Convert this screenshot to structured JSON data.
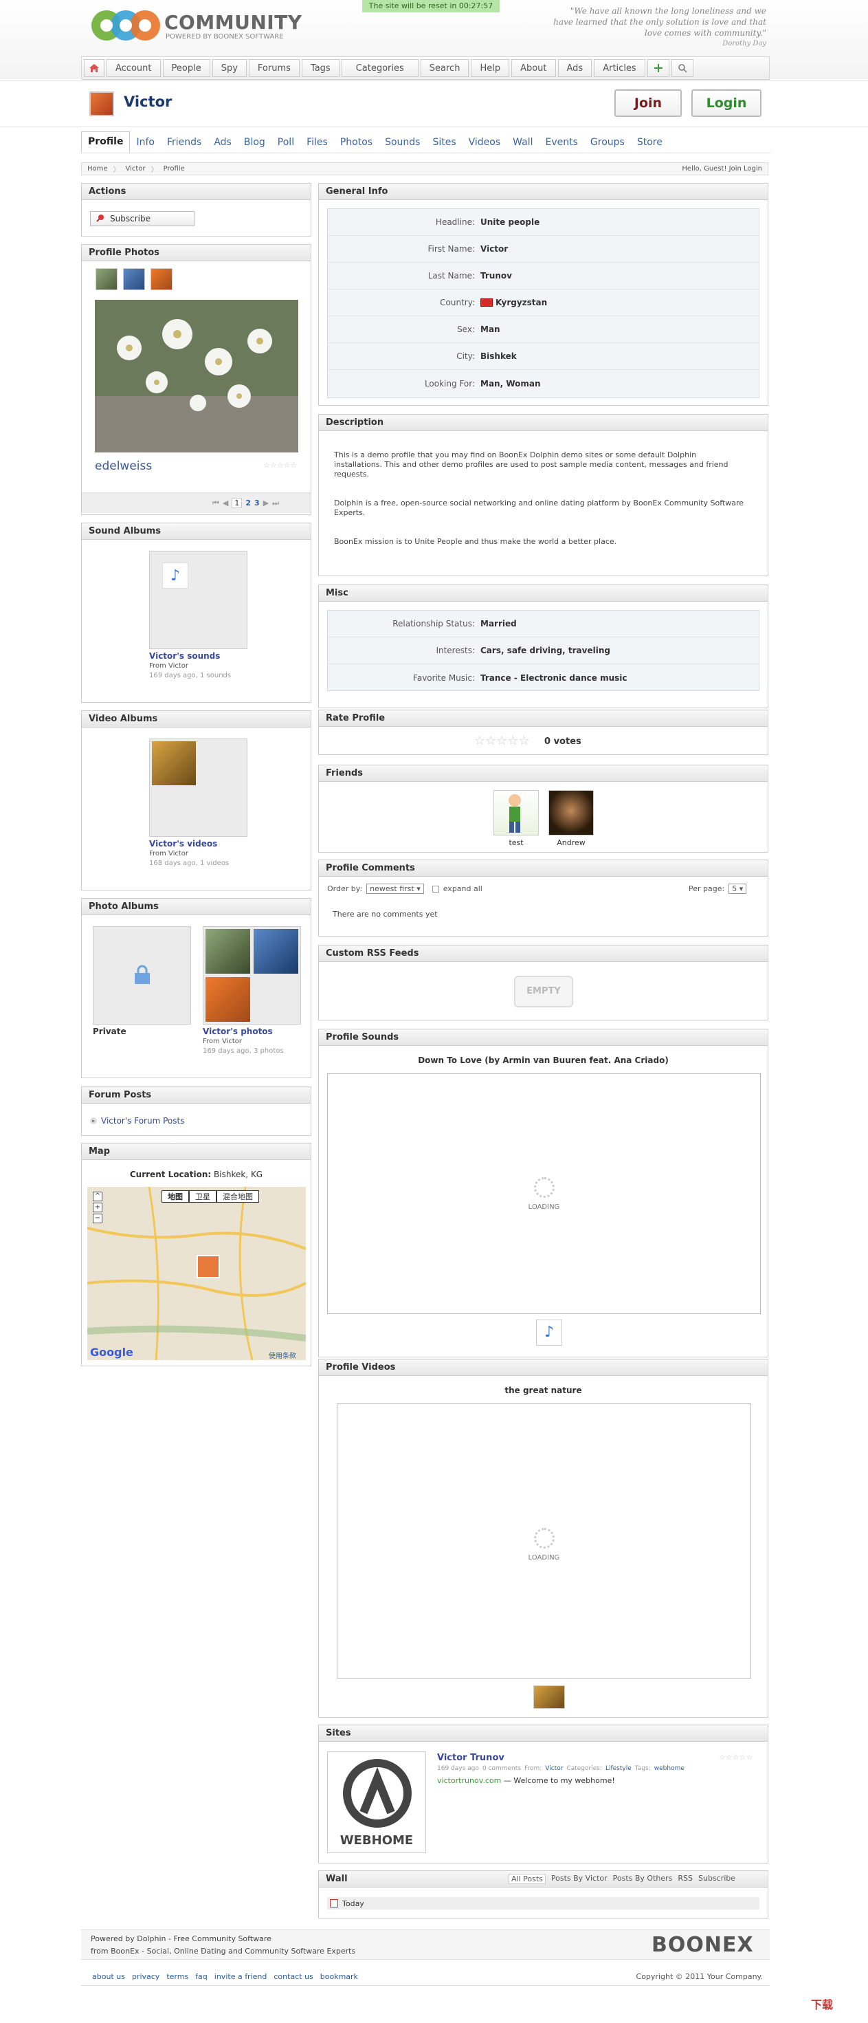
{
  "site": {
    "logo_title": "COMMUNITY",
    "logo_sub": "POWERED BY BOONEX SOFTWARE",
    "reset_notice": "The site will be reset in 00:27:57",
    "quote": "\"We have all known the long loneliness and we have learned that the only solution is love and that love comes with community.\"",
    "quote_author": "Dorothy Day"
  },
  "topnav": [
    "Account",
    "People",
    "Spy",
    "Forums",
    "Tags",
    "Categories",
    "Search",
    "Help",
    "About",
    "Ads",
    "Articles"
  ],
  "profile": {
    "name": "Victor",
    "join": "Join",
    "login": "Login"
  },
  "subnav": [
    "Profile",
    "Info",
    "Friends",
    "Ads",
    "Blog",
    "Poll",
    "Files",
    "Photos",
    "Sounds",
    "Sites",
    "Videos",
    "Wall",
    "Events",
    "Groups",
    "Store"
  ],
  "breadcrumb": [
    "Home",
    "Victor",
    "Profile"
  ],
  "hello": "Hello, Guest! Join Login",
  "actions": {
    "title": "Actions",
    "subscribe": "Subscribe"
  },
  "profile_photos": {
    "title": "Profile Photos",
    "caption": "edelweiss",
    "pages": [
      "1",
      "2",
      "3"
    ]
  },
  "sound_albums": {
    "title": "Sound Albums",
    "album": "Victor's sounds",
    "from": "From Victor",
    "meta": "169 days ago, 1 sounds"
  },
  "video_albums": {
    "title": "Video Albums",
    "album": "Victor's videos",
    "from": "From Victor",
    "meta": "168 days ago, 1 videos"
  },
  "photo_albums": {
    "title": "Photo Albums",
    "private": "Private",
    "album": "Victor's photos",
    "from": "From Victor",
    "meta": "169 days ago, 3 photos"
  },
  "forum_posts": {
    "title": "Forum Posts",
    "link": "Victor's Forum Posts"
  },
  "map": {
    "title": "Map",
    "location_label": "Current Location:",
    "location": "Bishkek, KG",
    "types": [
      "地图",
      "卫星",
      "混合地图"
    ],
    "terms": "使用条款",
    "google": "Google"
  },
  "general_info": {
    "title": "General Info",
    "rows": [
      {
        "label": "Headline:",
        "value": "Unite people"
      },
      {
        "label": "First Name:",
        "value": "Victor"
      },
      {
        "label": "Last Name:",
        "value": "Trunov"
      },
      {
        "label": "Country:",
        "value": "Kyrgyzstan"
      },
      {
        "label": "Sex:",
        "value": "Man"
      },
      {
        "label": "City:",
        "value": "Bishkek"
      },
      {
        "label": "Looking For:",
        "value": "Man, Woman"
      }
    ]
  },
  "description": {
    "title": "Description",
    "p1": "This is a demo profile that you may find on BoonEx Dolphin demo sites or some default Dolphin installations. This and other demo profiles are used to post sample media content, messages and friend requests.",
    "p2": "Dolphin is a free, open-source social networking and online dating platform by BoonEx Community Software Experts.",
    "p3": "BoonEx mission is to Unite People and thus make the world a better place."
  },
  "misc": {
    "title": "Misc",
    "rows": [
      {
        "label": "Relationship Status:",
        "value": "Married"
      },
      {
        "label": "Interests:",
        "value": "Cars, safe driving, traveling"
      },
      {
        "label": "Favorite Music:",
        "value": "Trance - Electronic dance music"
      }
    ]
  },
  "rate": {
    "title": "Rate Profile",
    "votes": "0 votes"
  },
  "friends": {
    "title": "Friends",
    "list": [
      "test",
      "Andrew"
    ]
  },
  "comments": {
    "title": "Profile Comments",
    "order_label": "Order by:",
    "order_value": "newest first",
    "expand": "expand all",
    "per_page_label": "Per page:",
    "per_page_value": "5",
    "empty": "There are no comments yet"
  },
  "rss": {
    "title": "Custom RSS Feeds",
    "empty": "EMPTY"
  },
  "sounds": {
    "title": "Profile Sounds",
    "track": "Down To Love (by Armin van Buuren feat. Ana Criado)",
    "loading": "LOADING"
  },
  "videos": {
    "title": "Profile Videos",
    "track": "the great nature",
    "loading": "LOADING"
  },
  "sites": {
    "title": "Sites",
    "name": "Victor Trunov",
    "meta_date": "169 days ago",
    "meta_comments": "0 comments",
    "meta_from_label": "From:",
    "meta_from": "Victor",
    "meta_cat_label": "Categories:",
    "meta_cat": "Lifestyle",
    "meta_tags_label": "Tags:",
    "meta_tags": "webhome",
    "url": "victortrunov.com",
    "desc": "— Welcome to my webhome!",
    "logo_text": "WEBHOME"
  },
  "wall": {
    "title": "Wall",
    "tabs": [
      "All Posts",
      "Posts By Victor",
      "Posts By Others",
      "RSS",
      "Subscribe"
    ],
    "today": "Today"
  },
  "footer": {
    "powered_by": "Powered by Dolphin - Free Community Software",
    "from_boonex": "from BoonEx - Social, Online Dating and Community Software Experts",
    "links": [
      "about us",
      "privacy",
      "terms",
      "faq",
      "invite a friend",
      "contact us",
      "bookmark"
    ],
    "copyright": "Copyright © 2011 Your Company.",
    "boonex": "BOONEX"
  },
  "watermark": "下载"
}
